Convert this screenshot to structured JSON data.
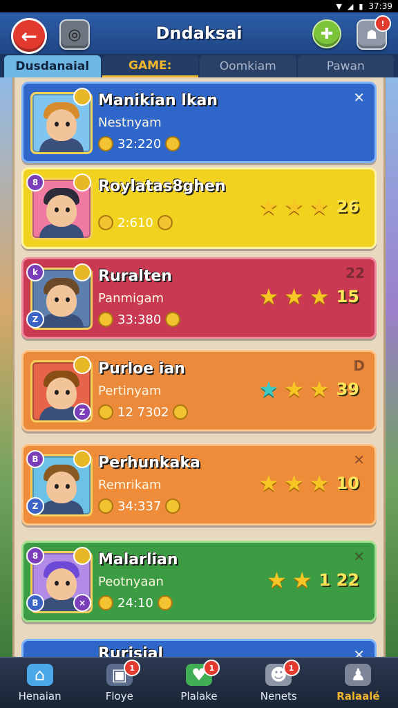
{
  "status": {
    "time": "37:39"
  },
  "header": {
    "title": "Dndaksai"
  },
  "tabs": [
    {
      "label": "Dusdanaial"
    },
    {
      "label": "GAME:"
    },
    {
      "label": "Oomkiam"
    },
    {
      "label": "Pawan"
    }
  ],
  "top_badges": {
    "chat": "!"
  },
  "cards": [
    {
      "name": "Manikian lkan",
      "subtitle": "Nestnyam",
      "coins": "32:220",
      "stars": 0,
      "score": "",
      "mark": "✕",
      "corner_tl": "",
      "corner_bl": "",
      "corner_br": ""
    },
    {
      "name": "Roylatas8ghen",
      "subtitle": "",
      "coins": "2:610",
      "stars": 3,
      "score": "26",
      "mark": "",
      "corner_tl": "8",
      "corner_bl": "",
      "corner_br": ""
    },
    {
      "name": "Ruralten",
      "subtitle": "Panmigam",
      "coins": "33:380",
      "stars": 3,
      "score": "15",
      "mark": "22",
      "corner_tl": "k",
      "corner_bl": "Z",
      "corner_br": ""
    },
    {
      "name": "Purloe ian",
      "subtitle": "Pertinyam",
      "coins": "12  7302",
      "stars": 3,
      "score": "39",
      "mark": "D",
      "corner_tl": "",
      "corner_bl": "",
      "corner_br": "Z"
    },
    {
      "name": "Perhunkaka",
      "subtitle": "Remrikam",
      "coins": "34:337",
      "stars": 3,
      "score": "10",
      "mark": "✕",
      "corner_tl": "B",
      "corner_bl": "Z",
      "corner_br": ""
    },
    {
      "name": "Malarlian",
      "subtitle": "Peotnyaan",
      "coins": "24:10",
      "stars": 2,
      "score": "1  22",
      "mark": "✕",
      "corner_tl": "8",
      "corner_bl": "B",
      "corner_br": "×"
    }
  ],
  "peek_card": {
    "name": "Rurisial",
    "mark": "✕"
  },
  "nav": [
    {
      "label": "Henaian",
      "icon": "home-icon",
      "badge": ""
    },
    {
      "label": "Floye",
      "icon": "screen-icon",
      "badge": "1"
    },
    {
      "label": "Plalake",
      "icon": "heart-icon",
      "badge": "1"
    },
    {
      "label": "Nenets",
      "icon": "chat-icon",
      "badge": "1"
    },
    {
      "label": "Ralaalé",
      "icon": "person-icon",
      "badge": ""
    }
  ],
  "colors": {
    "card_blue": "#2f66c9",
    "card_yellow": "#f1d21f",
    "card_red": "#c93a52",
    "card_orange": "#ec8a3b",
    "card_orange2": "#ee8c3a",
    "card_green": "#3c9c43"
  }
}
